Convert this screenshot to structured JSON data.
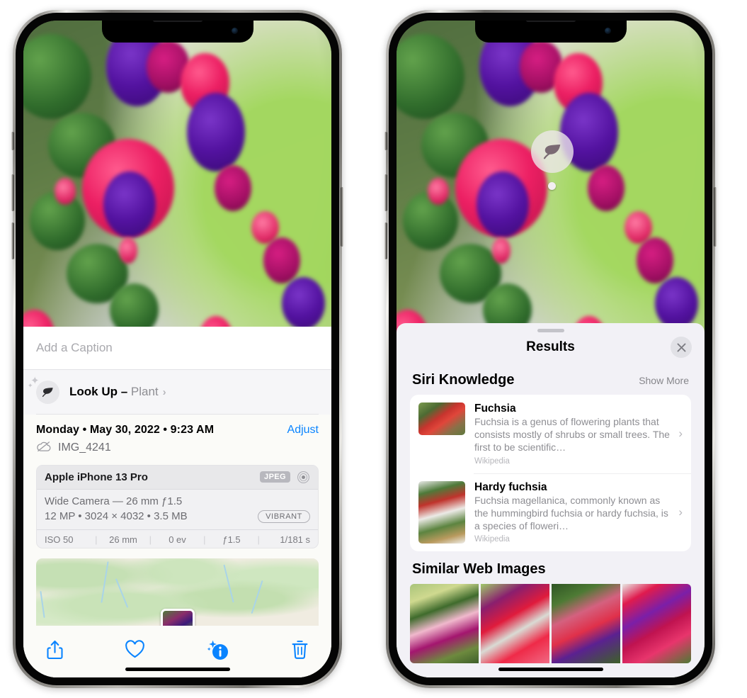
{
  "left_phone": {
    "caption": {
      "placeholder": "Add a Caption",
      "value": ""
    },
    "lookup": {
      "label": "Look Up – ",
      "subject": "Plant",
      "chevron": "›",
      "icon": "leaf-icon"
    },
    "meta": {
      "date": "Monday • May 30, 2022 • 9:23 AM",
      "adjust_label": "Adjust",
      "filename": "IMG_4241",
      "cloud_icon": "cloud-slash-icon"
    },
    "exif": {
      "device": "Apple iPhone 13 Pro",
      "format_badge": "JPEG",
      "aperture_icon": "aperture-icon",
      "lens_line": "Wide Camera — 26 mm ƒ1.5",
      "specs_line": "12 MP • 3024 × 4032 • 3.5 MB",
      "style_badge": "VIBRANT",
      "footer": [
        "ISO 50",
        "26 mm",
        "0 ev",
        "ƒ1.5",
        "1/181 s"
      ]
    },
    "toolbar": [
      {
        "name": "share-icon",
        "label": "Share"
      },
      {
        "name": "heart-icon",
        "label": "Favorite"
      },
      {
        "name": "info-sparkle-icon",
        "label": "Info"
      },
      {
        "name": "trash-icon",
        "label": "Delete"
      }
    ],
    "accent_color": "#0a84ff"
  },
  "right_phone": {
    "sheet": {
      "title": "Results",
      "close_icon": "close-icon"
    },
    "visual_lookup_badge": {
      "icon": "leaf-icon"
    },
    "siri_knowledge": {
      "title": "Siri Knowledge",
      "show_more": "Show More",
      "items": [
        {
          "title": "Fuchsia",
          "description": "Fuchsia is a genus of flowering plants that consists mostly of shrubs or small trees. The first to be scientific…",
          "source": "Wikipedia",
          "thumb": "fuchsia-flowers-thumbnail"
        },
        {
          "title": "Hardy fuchsia",
          "description": "Fuchsia magellanica, commonly known as the hummingbird fuchsia or hardy fuchsia, is a species of floweri…",
          "source": "Wikipedia",
          "thumb": "hardy-fuchsia-thumbnail"
        }
      ]
    },
    "similar_web_images": {
      "title": "Similar Web Images",
      "items": [
        "web-image-1",
        "web-image-2",
        "web-image-3",
        "web-image-4"
      ]
    }
  }
}
